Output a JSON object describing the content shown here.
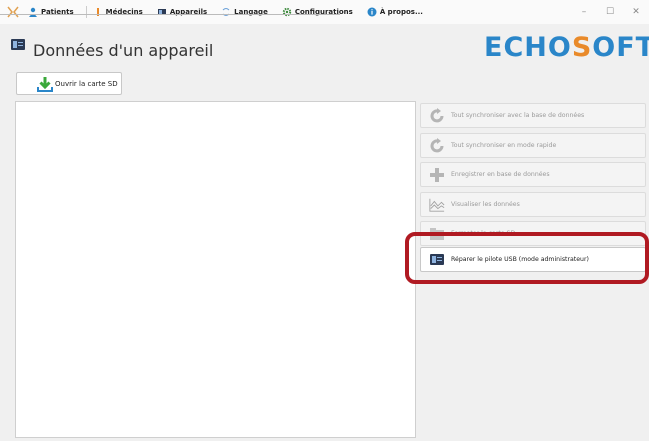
{
  "menubar": {
    "items": [
      {
        "label": "Patients",
        "icon": "person-icon"
      },
      {
        "label": "Médecins",
        "icon": "doctor-icon"
      },
      {
        "label": "Appareils",
        "icon": "device-icon"
      },
      {
        "label": "Langage",
        "icon": "language-icon"
      },
      {
        "label": "Configurations",
        "icon": "gear-icon"
      },
      {
        "label": "À propos...",
        "icon": "info-icon"
      }
    ],
    "window_controls": [
      "–",
      "☐",
      "✕"
    ]
  },
  "header": {
    "title": "Données d'un appareil",
    "brand_left": "ECHO",
    "brand_s": "S",
    "brand_right": "OFT"
  },
  "open_sd_button": {
    "label": "Ouvrir la carte SD"
  },
  "actions": [
    {
      "label": "Tout synchroniser avec la base de données",
      "icon": "sync-icon",
      "enabled": false
    },
    {
      "label": "Tout synchroniser en mode rapide",
      "icon": "sync-icon",
      "enabled": false
    },
    {
      "label": "Enregistrer en base de données",
      "icon": "plus-icon",
      "enabled": false
    },
    {
      "label": "Visualiser les données",
      "icon": "chart-icon",
      "enabled": false
    },
    {
      "label": "Formater la carte SD",
      "icon": "folder-icon",
      "enabled": false
    },
    {
      "label": "Réparer le pilote USB (mode administrateur)",
      "icon": "usb-device-icon",
      "enabled": true
    }
  ],
  "colors": {
    "brand_blue": "#2a86c9",
    "brand_orange": "#e98a2a",
    "highlight_red": "#b01a22",
    "disabled_text": "#9a9a9a"
  }
}
